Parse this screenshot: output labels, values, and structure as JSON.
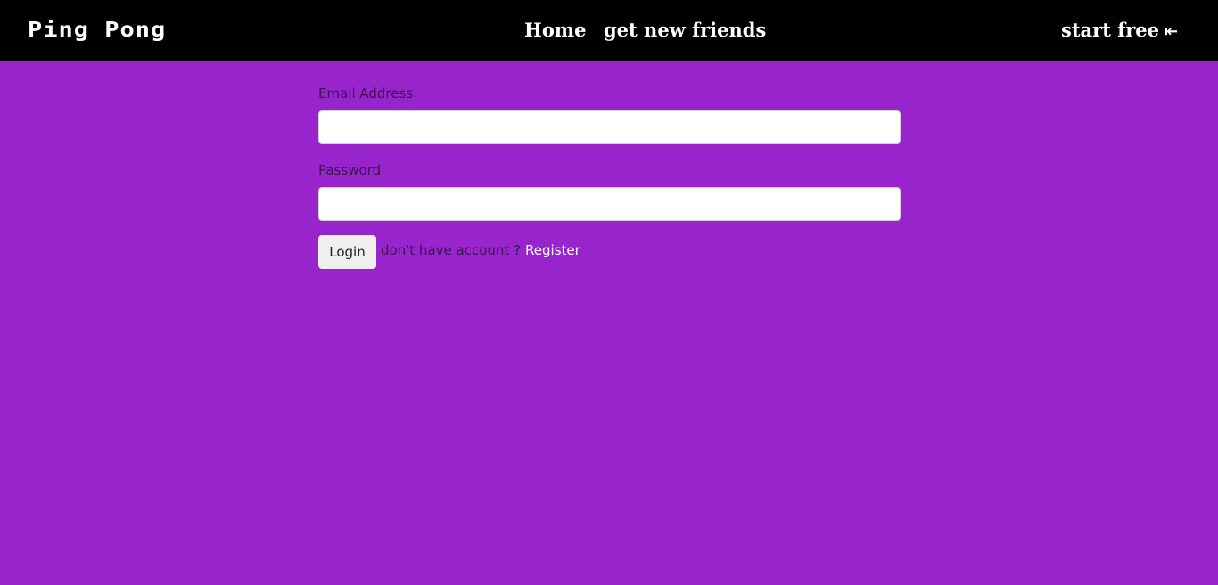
{
  "navbar": {
    "brand": "Ping Pong",
    "links": {
      "home": "Home",
      "friends": "get new friends",
      "start": "start free",
      "start_icon": "⇤"
    },
    "start_icon_name": "arrow-to-left-icon"
  },
  "form": {
    "email_label": "Email Address",
    "email_value": "",
    "password_label": "Password",
    "password_value": "",
    "login_label": "Login",
    "prompt": "don't have account ?",
    "register_label": "Register"
  },
  "colors": {
    "background": "#9725cb",
    "navbar": "#000000",
    "nav_text": "#ffffff",
    "label_text": "#3b1550",
    "register_link": "#ffffff"
  }
}
